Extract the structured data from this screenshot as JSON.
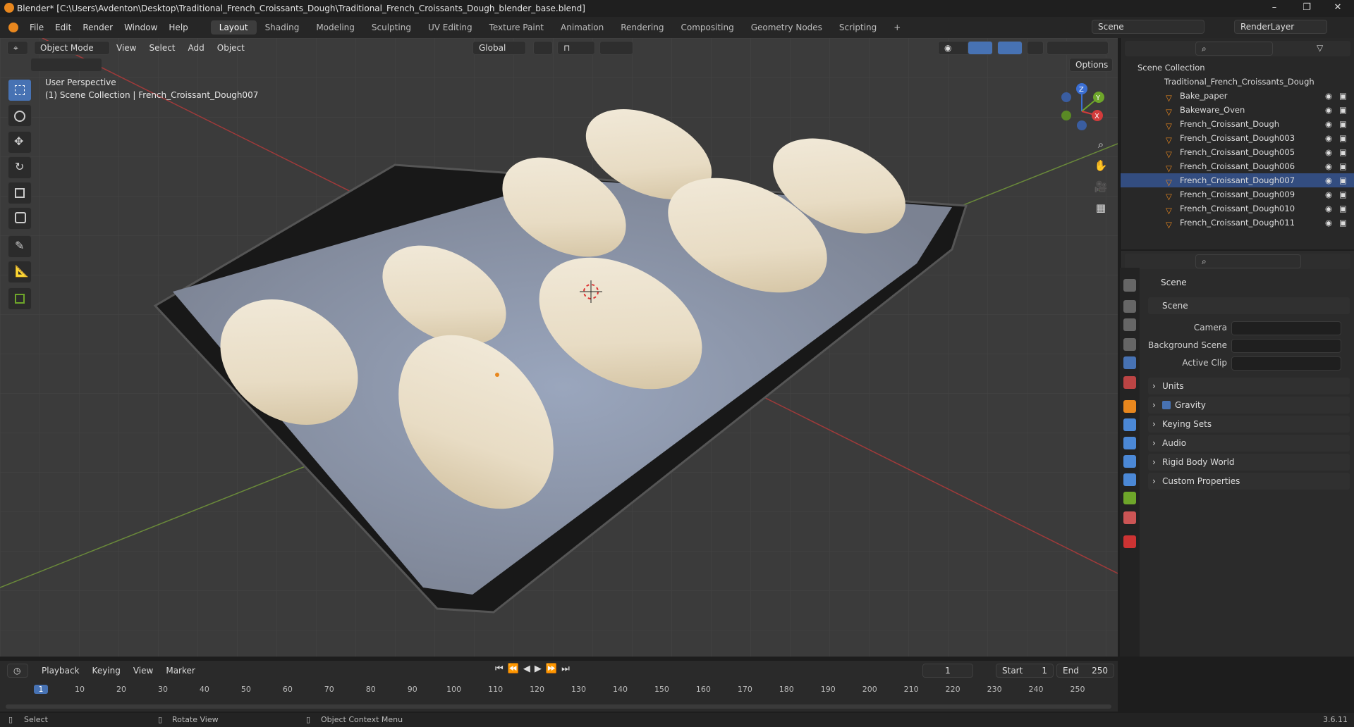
{
  "window": {
    "title": "Blender* [C:\\Users\\Avdenton\\Desktop\\Traditional_French_Croissants_Dough\\Traditional_French_Croissants_Dough_blender_base.blend]",
    "minimize": "–",
    "maximize": "❐",
    "close": "✕"
  },
  "menu": [
    "File",
    "Edit",
    "Render",
    "Window",
    "Help"
  ],
  "workspaces": [
    {
      "label": "Layout",
      "active": true
    },
    {
      "label": "Shading"
    },
    {
      "label": "Modeling"
    },
    {
      "label": "Sculpting"
    },
    {
      "label": "UV Editing"
    },
    {
      "label": "Texture Paint"
    },
    {
      "label": "Animation"
    },
    {
      "label": "Rendering"
    },
    {
      "label": "Compositing"
    },
    {
      "label": "Geometry Nodes"
    },
    {
      "label": "Scripting"
    }
  ],
  "add_workspace": "+",
  "scene_selector": "Scene",
  "renderlayer_selector": "RenderLayer",
  "viewport": {
    "mode": "Object Mode",
    "menus": [
      "View",
      "Select",
      "Add",
      "Object"
    ],
    "transform": "Global",
    "options": "Options",
    "overlay_title": "User Perspective",
    "overlay_sub": "(1) Scene Collection | French_Croissant_Dough007",
    "axis": {
      "x": "X",
      "y": "Y",
      "z": "Z"
    }
  },
  "outliner": {
    "root": "Scene Collection",
    "collection": "Traditional_French_Croissants_Dough",
    "items": [
      "Bake_paper",
      "Bakeware_Oven",
      "French_Croissant_Dough",
      "French_Croissant_Dough003",
      "French_Croissant_Dough005",
      "French_Croissant_Dough006",
      "French_Croissant_Dough007",
      "French_Croissant_Dough009",
      "French_Croissant_Dough010",
      "French_Croissant_Dough011"
    ],
    "active_index": 6
  },
  "properties": {
    "header": "Scene",
    "section": "Scene",
    "fields": [
      {
        "label": "Camera"
      },
      {
        "label": "Background Scene"
      },
      {
        "label": "Active Clip"
      }
    ],
    "collapsed": [
      "Units",
      "Gravity",
      "Keying Sets",
      "Audio",
      "Rigid Body World",
      "Custom Properties"
    ],
    "gravity_checked": true
  },
  "timeline": {
    "menus": [
      "Playback",
      "Keying",
      "View",
      "Marker"
    ],
    "current_frame": "1",
    "start_label": "Start",
    "start": "1",
    "end_label": "End",
    "end": "250",
    "ticks": [
      "1",
      "10",
      "20",
      "30",
      "40",
      "50",
      "60",
      "70",
      "80",
      "90",
      "100",
      "110",
      "120",
      "130",
      "140",
      "150",
      "160",
      "170",
      "180",
      "190",
      "200",
      "210",
      "220",
      "230",
      "240",
      "250"
    ]
  },
  "status": {
    "select": "Select",
    "rotate": "Rotate View",
    "context": "Object Context Menu",
    "version": "3.6.11"
  },
  "colors": {
    "accent": "#4772b3",
    "orange": "#e8871e",
    "active_row": "#334d80"
  }
}
